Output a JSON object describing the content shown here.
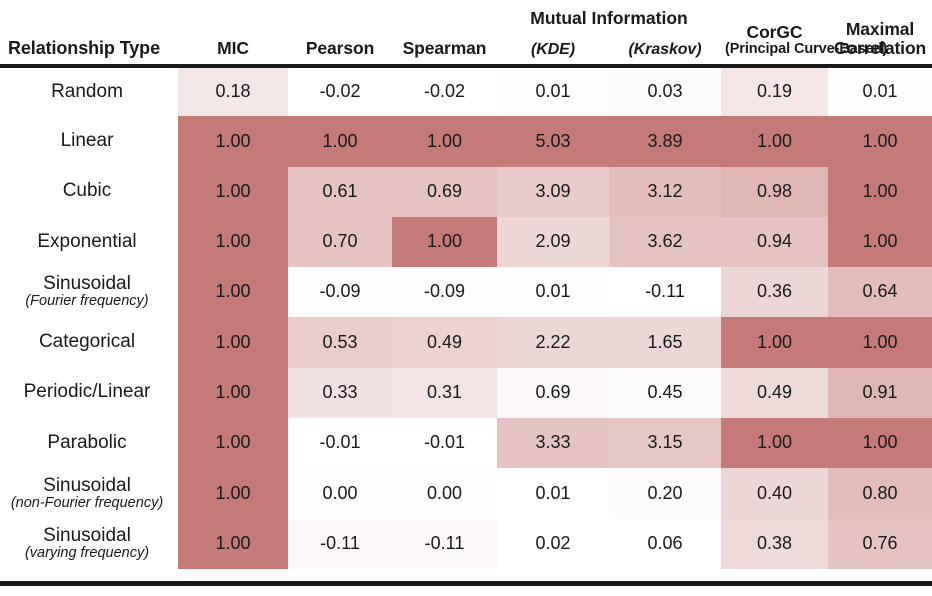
{
  "table": {
    "columns": [
      {
        "key": "relationship",
        "main": "Relationship Type",
        "sub": ""
      },
      {
        "key": "mic",
        "main": "MIC",
        "sub": ""
      },
      {
        "key": "pearson",
        "main": "Pearson",
        "sub": ""
      },
      {
        "key": "spearman",
        "main": "Spearman",
        "sub": ""
      },
      {
        "key": "mi_kde",
        "main": "",
        "sub": "(KDE)"
      },
      {
        "key": "mi_kraskov",
        "main": "",
        "sub": "(Kraskov)"
      },
      {
        "key": "corgc",
        "main": "CorGC",
        "sub": "(Principal Curve-Based)"
      },
      {
        "key": "maximal_correlation",
        "main": "Maximal Correlation",
        "sub": ""
      }
    ],
    "group_headers": [
      {
        "key": "mutual_information",
        "label": "Mutual Information"
      }
    ],
    "rows": [
      {
        "name": "Random",
        "sub": "",
        "values": [
          "0.18",
          "-0.02",
          "-0.02",
          "0.01",
          "0.03",
          "0.19",
          "0.01"
        ],
        "shades": [
          0.18,
          0.0,
          0.0,
          0.01,
          0.03,
          0.19,
          0.01
        ]
      },
      {
        "name": "Linear",
        "sub": "",
        "values": [
          "1.00",
          "1.00",
          "1.00",
          "5.03",
          "3.89",
          "1.00",
          "1.00"
        ],
        "shades": [
          1.0,
          1.0,
          1.0,
          1.0,
          1.0,
          1.0,
          1.0
        ]
      },
      {
        "name": "Cubic",
        "sub": "",
        "values": [
          "1.00",
          "0.61",
          "0.69",
          "3.09",
          "3.12",
          "0.98",
          "1.00"
        ],
        "shades": [
          1.0,
          0.45,
          0.45,
          0.39,
          0.5,
          0.55,
          1.0
        ]
      },
      {
        "name": "Exponential",
        "sub": "",
        "values": [
          "1.00",
          "0.70",
          "1.00",
          "2.09",
          "3.62",
          "0.94",
          "1.00"
        ],
        "shades": [
          1.0,
          0.45,
          1.0,
          0.3,
          0.45,
          0.45,
          1.0
        ]
      },
      {
        "name": "Sinusoidal",
        "sub": "(Fourier frequency)",
        "values": [
          "1.00",
          "-0.09",
          "-0.09",
          "0.01",
          "-0.11",
          "0.36",
          "0.64"
        ],
        "shades": [
          1.0,
          0.02,
          0.02,
          0.01,
          0.0,
          0.3,
          0.5
        ]
      },
      {
        "name": "Categorical",
        "sub": "",
        "values": [
          "1.00",
          "0.53",
          "0.49",
          "2.22",
          "1.65",
          "1.00",
          "1.00"
        ],
        "shades": [
          1.0,
          0.38,
          0.33,
          0.3,
          0.3,
          1.0,
          1.0
        ]
      },
      {
        "name": "Periodic/Linear",
        "sub": "",
        "values": [
          "1.00",
          "0.33",
          "0.31",
          "0.69",
          "0.45",
          "0.49",
          "0.91"
        ],
        "shades": [
          1.0,
          0.22,
          0.2,
          0.05,
          0.03,
          0.28,
          0.55
        ]
      },
      {
        "name": "Parabolic",
        "sub": "",
        "values": [
          "1.00",
          "-0.01",
          "-0.01",
          "3.33",
          "3.15",
          "1.00",
          "1.00"
        ],
        "shades": [
          1.0,
          0.0,
          0.0,
          0.45,
          0.42,
          1.0,
          1.0
        ]
      },
      {
        "name": "Sinusoidal",
        "sub": "(non-Fourier frequency)",
        "values": [
          "1.00",
          "0.00",
          "0.00",
          "0.01",
          "0.20",
          "0.40",
          "0.80"
        ],
        "shades": [
          1.0,
          0.01,
          0.01,
          0.0,
          0.03,
          0.3,
          0.5
        ]
      },
      {
        "name": "Sinusoidal",
        "sub": "(varying frequency)",
        "values": [
          "1.00",
          "-0.11",
          "-0.11",
          "0.02",
          "0.06",
          "0.38",
          "0.76"
        ],
        "shades": [
          1.0,
          0.05,
          0.05,
          0.0,
          0.0,
          0.28,
          0.45
        ]
      }
    ],
    "colors": {
      "heat_min": "#ffffff",
      "heat_max": "#c47a77",
      "rule": "#1a1a1a",
      "text": "#1a1a1a",
      "background": "#ffffff"
    }
  }
}
